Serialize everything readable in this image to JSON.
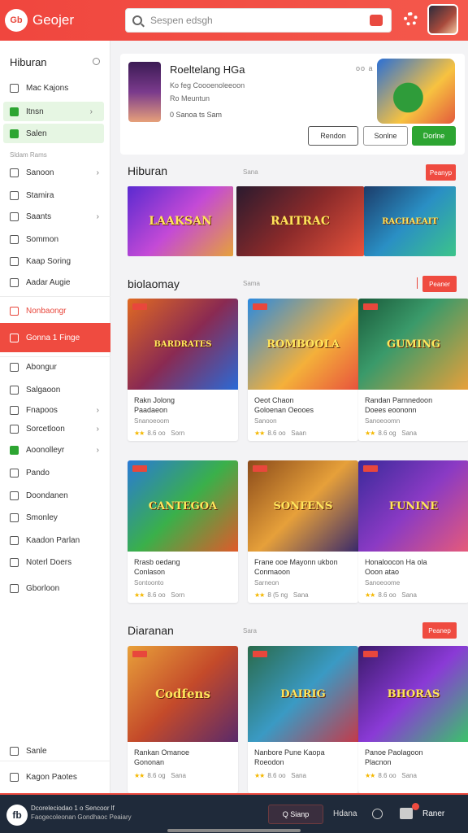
{
  "header": {
    "logo_mark": "Gb",
    "logo_text": "Geojer",
    "search_placeholder": "Sespen edsgh"
  },
  "sidebar": {
    "title": "Hiburan",
    "section_label": "Sldam Rams",
    "items": [
      {
        "label": "Mac Kajons"
      },
      {
        "label": "Itnsn"
      },
      {
        "label": "Salen"
      },
      {
        "label": "Sanoon"
      },
      {
        "label": "Stamira"
      },
      {
        "label": "Saants"
      },
      {
        "label": "Sommon"
      },
      {
        "label": "Kaap Soring"
      },
      {
        "label": "Aadar Augie"
      },
      {
        "label": "Nonbaongr"
      },
      {
        "label": "Gonna 1 Finge"
      },
      {
        "label": "Abongur"
      },
      {
        "label": "Salgaoon"
      },
      {
        "label": "Fnapoos"
      },
      {
        "label": "Sorcetloon"
      },
      {
        "label": "Aoonolleyr"
      },
      {
        "label": "Pando"
      },
      {
        "label": "Doondanen"
      },
      {
        "label": "Smonley"
      },
      {
        "label": "Kaadon Parlan"
      },
      {
        "label": "Noterl Doers"
      },
      {
        "label": "Gborloon"
      },
      {
        "label": "Sanle"
      },
      {
        "label": "Kagon Paotes"
      }
    ]
  },
  "featured": {
    "title": "Roeltelang HGa",
    "sub1": "Ko feg Coooenoleeoon",
    "sub2": "Ro Meuntun",
    "meta": "0  Sanoa ts  Sam",
    "dots": "oo a",
    "buttons": {
      "b1": "Rendon",
      "b2": "Sonlne",
      "b3": "Dorlne"
    }
  },
  "sections": [
    {
      "title": "Hiburan",
      "meta": "Sana",
      "tag": "Peanyp",
      "banners": [
        "LAAKSAN",
        "RAITRAC",
        "RACHAEAIT"
      ]
    },
    {
      "title": "biolaomay",
      "meta": "Sama",
      "tag": "Peaner",
      "cards": [
        {
          "art": "BARDRATES",
          "name1": "Rakn Jolong",
          "name2": "Paadaeon",
          "sub": "Snanoeoom",
          "rating": "8.6 oo",
          "rating_extra": "Sorn"
        },
        {
          "art": "ROMBOOLA",
          "name1": "Oeot Chaon",
          "name2": "Goloenan Oeooes",
          "sub": "Sanoon",
          "rating": "8.6 oo",
          "rating_extra": "Saan"
        },
        {
          "art": "GUMING",
          "name1": "Randan Parnnedoon",
          "name2": "Doees eoononn",
          "sub": "Sanoeoomn",
          "rating": "8.6 og",
          "rating_extra": "Sana"
        },
        {
          "art": "CANTEGOA",
          "name1": "Rrasb oedang",
          "name2": "Conlason",
          "sub": "Sontoonto",
          "rating": "8.6 oo",
          "rating_extra": "Sorn"
        },
        {
          "art": "SONFENS",
          "name1": "Frane ooe Mayonn ukbon",
          "name2": "Conmaoon",
          "sub": "Sarneon",
          "rating": "8 (5 ng",
          "rating_extra": "Sana"
        },
        {
          "art": "FUNINE",
          "name1": "Honaloocon Ha ola",
          "name2": "Ooon atao",
          "sub": "Sanoeoome",
          "rating": "8.6 oo",
          "rating_extra": "Sana"
        }
      ]
    },
    {
      "title": "Diaranan",
      "meta": "Sara",
      "tag": "Peanep",
      "cards": [
        {
          "art": "Codfens",
          "name1": "Rankan Omanoe",
          "name2": "Gononan",
          "sub": "",
          "rating": "8.6 og",
          "rating_extra": "Sana"
        },
        {
          "art": "DAIRIG",
          "name1": "Nanbore Pune Kaopa",
          "name2": "Roeodon",
          "sub": "",
          "rating": "8.6 oo",
          "rating_extra": "Sana"
        },
        {
          "art": "BHORAS",
          "name1": "Panoe Paolagoon",
          "name2": "Placnon",
          "sub": "",
          "rating": "8.6 oo",
          "rating_extra": "Sana"
        }
      ]
    }
  ],
  "bottom": {
    "logo_mark": "fb",
    "text1": "Dcoreleciodao 1   o  Sencoor lf",
    "text2": "Faogecoleonan Gondhaoc Peaiary",
    "search": "Q Sianp",
    "link": "Hdana",
    "cart": "Raner"
  },
  "colors": {
    "accent": "#ef4b40",
    "green": "#2da532",
    "dark": "#1f2a3a"
  }
}
